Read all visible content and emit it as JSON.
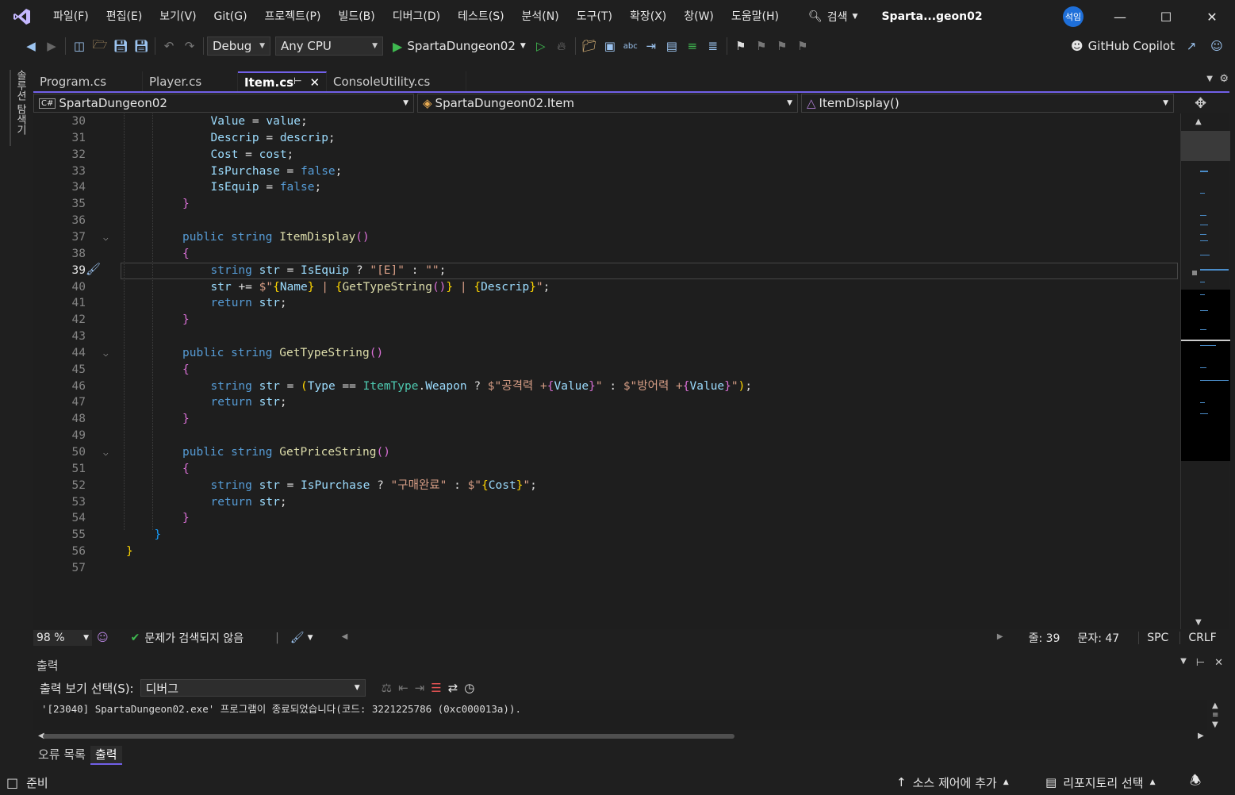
{
  "menubar": {
    "items": [
      "파일(F)",
      "편집(E)",
      "보기(V)",
      "Git(G)",
      "프로젝트(P)",
      "빌드(B)",
      "디버그(D)",
      "테스트(S)",
      "분석(N)",
      "도구(T)",
      "확장(X)",
      "창(W)",
      "도움말(H)"
    ],
    "search_label": "검색",
    "solution_title": "Sparta...geon02",
    "user_initials": "석임"
  },
  "toolbar": {
    "configuration": "Debug",
    "platform": "Any CPU",
    "run_target": "SpartaDungeon02",
    "copilot_label": "GitHub Copilot"
  },
  "side_strip": {
    "label": "솔루션 탐색기"
  },
  "tabs": [
    {
      "label": "Program.cs",
      "active": false
    },
    {
      "label": "Player.cs",
      "active": false
    },
    {
      "label": "Item.cs",
      "active": true
    },
    {
      "label": "ConsoleUtility.cs",
      "active": false
    }
  ],
  "navbar": {
    "project": "SpartaDungeon02",
    "class": "SpartaDungeon02.Item",
    "member": "ItemDisplay()"
  },
  "editor": {
    "current_line": 39,
    "lines": [
      {
        "n": "30",
        "html": "<span class='vr'>Value</span> <span class='pl'>=</span> <span class='vr'>value</span><span class='pl'>;</span>",
        "indent": 3
      },
      {
        "n": "31",
        "html": "<span class='vr'>Descrip</span> <span class='pl'>=</span> <span class='vr'>descrip</span><span class='pl'>;</span>",
        "indent": 3
      },
      {
        "n": "32",
        "html": "<span class='vr'>Cost</span> <span class='pl'>=</span> <span class='vr'>cost</span><span class='pl'>;</span>",
        "indent": 3
      },
      {
        "n": "33",
        "html": "<span class='vr'>IsPurchase</span> <span class='pl'>=</span> <span class='kw'>false</span><span class='pl'>;</span>",
        "indent": 3
      },
      {
        "n": "34",
        "html": "<span class='vr'>IsEquip</span> <span class='pl'>=</span> <span class='kw'>false</span><span class='pl'>;</span>",
        "indent": 3
      },
      {
        "n": "35",
        "html": "<span class='br1'>}</span>",
        "indent": 2
      },
      {
        "n": "36",
        "html": "",
        "indent": 0
      },
      {
        "n": "37",
        "html": "<span class='kw'>public</span> <span class='kw'>string</span> <span class='fn'>ItemDisplay</span><span class='br1'>()</span>",
        "indent": 2,
        "fold": true
      },
      {
        "n": "38",
        "html": "<span class='br1'>{</span>",
        "indent": 2
      },
      {
        "n": "39",
        "html": "<span class='kw'>string</span> <span class='vr'>str</span> <span class='pl'>=</span> <span class='vr'>IsEquip</span> <span class='pl'>?</span> <span class='st'>\"[E]\"</span> <span class='pl'>:</span> <span class='st'>\"\"</span><span class='pl'>;</span>",
        "indent": 3
      },
      {
        "n": "40",
        "html": "<span class='vr'>str</span> <span class='pl'>+=</span> <span class='st'>$\"</span><span class='br2'>{</span><span class='vr'>Name</span><span class='br2'>}</span><span class='st'> | </span><span class='br2'>{</span><span class='fn'>GetTypeString</span><span class='br1'>()</span><span class='br2'>}</span><span class='st'> | </span><span class='br2'>{</span><span class='vr'>Descrip</span><span class='br2'>}</span><span class='st'>\"</span><span class='pl'>;</span>",
        "indent": 3
      },
      {
        "n": "41",
        "html": "<span class='kw'>return</span> <span class='vr'>str</span><span class='pl'>;</span>",
        "indent": 3
      },
      {
        "n": "42",
        "html": "<span class='br1'>}</span>",
        "indent": 2
      },
      {
        "n": "43",
        "html": "",
        "indent": 0
      },
      {
        "n": "44",
        "html": "<span class='kw'>public</span> <span class='kw'>string</span> <span class='fn'>GetTypeString</span><span class='br1'>()</span>",
        "indent": 2,
        "fold": true
      },
      {
        "n": "45",
        "html": "<span class='br1'>{</span>",
        "indent": 2
      },
      {
        "n": "46",
        "html": "<span class='kw'>string</span> <span class='vr'>str</span> <span class='pl'>=</span> <span class='br2'>(</span><span class='vr'>Type</span> <span class='pl'>==</span> <span class='tp'>ItemType</span><span class='pl'>.</span><span class='vr'>Weapon</span> <span class='pl'>?</span> <span class='st'>$\"공격력 +</span><span class='br1'>{</span><span class='vr'>Value</span><span class='br1'>}</span><span class='st'>\"</span> <span class='pl'>:</span> <span class='st'>$\"방어력 +</span><span class='br1'>{</span><span class='vr'>Value</span><span class='br1'>}</span><span class='st'>\"</span><span class='br2'>)</span><span class='pl'>;</span>",
        "indent": 3
      },
      {
        "n": "47",
        "html": "<span class='kw'>return</span> <span class='vr'>str</span><span class='pl'>;</span>",
        "indent": 3
      },
      {
        "n": "48",
        "html": "<span class='br1'>}</span>",
        "indent": 2
      },
      {
        "n": "49",
        "html": "",
        "indent": 0
      },
      {
        "n": "50",
        "html": "<span class='kw'>public</span> <span class='kw'>string</span> <span class='fn'>GetPriceString</span><span class='br1'>()</span>",
        "indent": 2,
        "fold": true
      },
      {
        "n": "51",
        "html": "<span class='br1'>{</span>",
        "indent": 2
      },
      {
        "n": "52",
        "html": "<span class='kw'>string</span> <span class='vr'>str</span> <span class='pl'>=</span> <span class='vr'>IsPurchase</span> <span class='pl'>?</span> <span class='st'>\"구매완료\"</span> <span class='pl'>:</span> <span class='st'>$\"</span><span class='br2'>{</span><span class='vr'>Cost</span><span class='br2'>}</span><span class='st'>\"</span><span class='pl'>;</span>",
        "indent": 3
      },
      {
        "n": "53",
        "html": "<span class='kw'>return</span> <span class='vr'>str</span><span class='pl'>;</span>",
        "indent": 3
      },
      {
        "n": "54",
        "html": "<span class='br1'>}</span>",
        "indent": 2
      },
      {
        "n": "55",
        "html": "<span class='br3'>}</span>",
        "indent": 1
      },
      {
        "n": "56",
        "html": "<span class='br2'>}</span>",
        "indent": 0
      },
      {
        "n": "57",
        "html": "",
        "indent": 0
      }
    ]
  },
  "editor_status": {
    "zoom": "98 %",
    "issues": "문제가 검색되지 않음",
    "line": "줄: 39",
    "col": "문자: 47",
    "whitespace": "SPC",
    "line_ending": "CRLF"
  },
  "output": {
    "title": "출력",
    "source_label": "출력 보기 선택(S):",
    "source_value": "디버그",
    "text": "'[23040] SpartaDungeon02.exe' 프로그램이 종료되었습니다(코드: 3221225786 (0xc000013a))."
  },
  "bottom_tabs": [
    {
      "label": "오류 목록",
      "active": false
    },
    {
      "label": "출력",
      "active": true
    }
  ],
  "statusbar": {
    "ready": "준비",
    "source_control": "소스 제어에 추가",
    "repository": "리포지토리 선택"
  },
  "colors": {
    "accent": "#7160e8",
    "background": "#1f1f1f",
    "editor_bg": "#1e1e1e"
  }
}
